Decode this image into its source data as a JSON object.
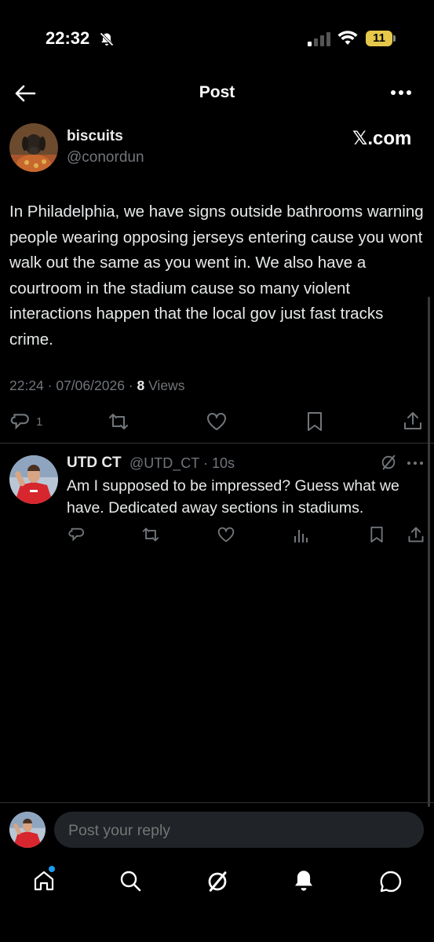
{
  "status_bar": {
    "time": "22:32",
    "battery": "11"
  },
  "header": {
    "title": "Post",
    "back_icon": "arrow-left-icon",
    "more_icon": "more-dots-icon"
  },
  "post": {
    "display_name": "biscuits",
    "handle": "@conordun",
    "watermark": "𝕏.com",
    "text": "In Philadelphia, we have signs outside bathrooms warning people wearing opposing jerseys entering cause you wont walk out the same as you went in. We also have a courtroom in the stadium cause so many violent interactions happen that the local gov just fast tracks crime.",
    "timestamp": "22:24 · 07/06/2026 · ",
    "views_count": "8",
    "views_label": " Views",
    "reply_count": "1"
  },
  "reply": {
    "display_name": "UTD CT",
    "handle": "@UTD_CT · 10s",
    "text": "Am I supposed to be impressed? Guess what we have. Dedicated away sections in stadiums."
  },
  "composer": {
    "placeholder": "Post your reply"
  },
  "bottom_nav": [
    "home-icon",
    "search-icon",
    "grok-icon",
    "notifications-icon",
    "messages-icon"
  ],
  "colors": {
    "background": "#000000",
    "text": "#e7e9ea",
    "muted": "#71767b",
    "accent": "#1d9bf0",
    "battery": "#e6c84a"
  }
}
